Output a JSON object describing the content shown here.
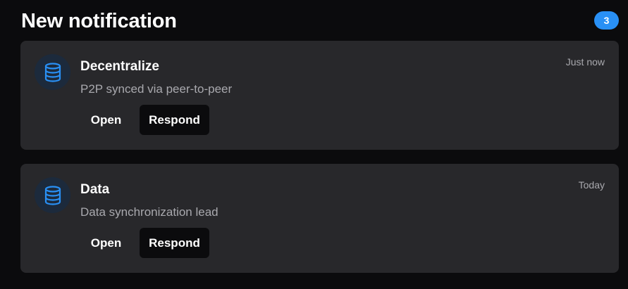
{
  "header": {
    "title": "New notification",
    "count": "3"
  },
  "notifications": [
    {
      "icon": "database-icon",
      "title": "Decentralize",
      "message": "P2P synced via peer-to-peer",
      "time": "Just now",
      "open_label": "Open",
      "respond_label": "Respond"
    },
    {
      "icon": "database-icon",
      "title": "Data",
      "message": "Data synchronization lead",
      "time": "Today",
      "open_label": "Open",
      "respond_label": "Respond"
    }
  ],
  "colors": {
    "background": "#0b0b0d",
    "card": "#28282b",
    "accent": "#2990f5",
    "icon_bg": "#1c2a3c",
    "muted_text": "#a9a9ae"
  }
}
